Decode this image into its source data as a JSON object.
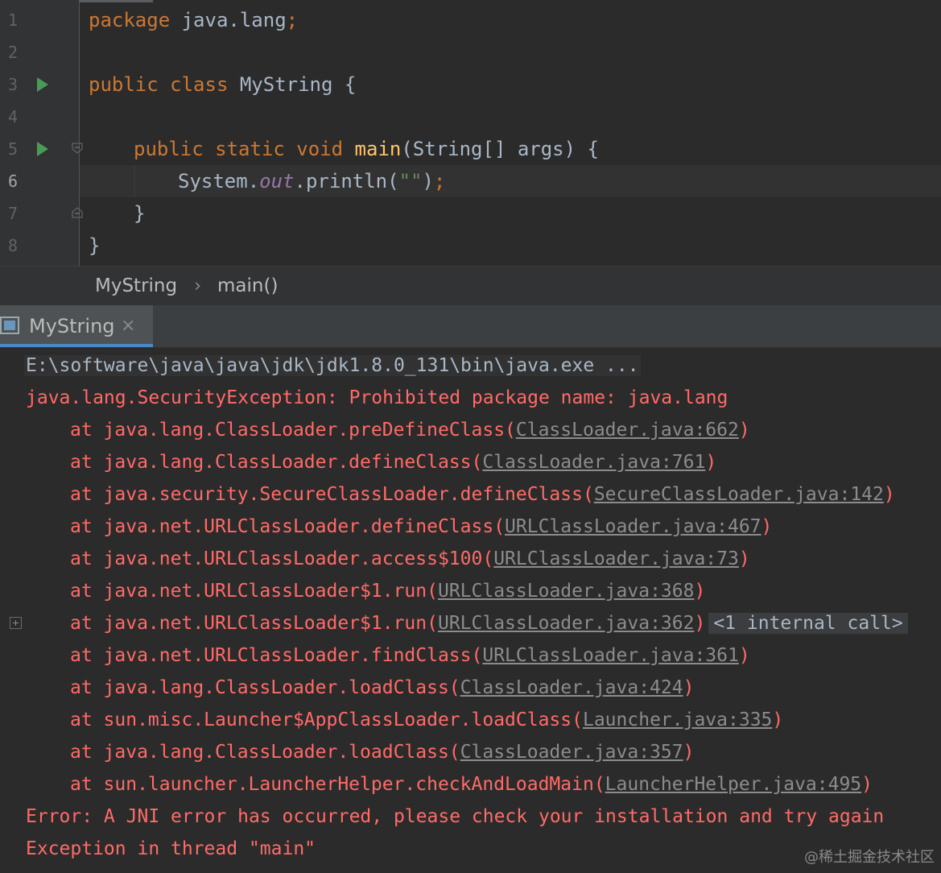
{
  "editor": {
    "line_numbers": [
      "1",
      "2",
      "3",
      "4",
      "5",
      "6",
      "7",
      "8"
    ],
    "lines": {
      "l1": {
        "kw": "package",
        "rest": " java.lang",
        "semi": ";"
      },
      "l3": {
        "kw": "public class",
        "rest": " MyString {"
      },
      "l5": {
        "kw": "public static void",
        "sp": " ",
        "fn": "main",
        "rest": "(String[] args) {"
      },
      "l6": {
        "a": "System.",
        "field": "out",
        "b": ".println(",
        "str": "\"\"",
        "c": ")",
        "semi": ";"
      },
      "l7": {
        "rest": "}"
      },
      "l8": {
        "rest": "}"
      }
    }
  },
  "breadcrumb": {
    "class": "MyString",
    "separator": "›",
    "method": "main()"
  },
  "run_panel": {
    "tab_label": "MyString",
    "close_glyph": "×"
  },
  "console": {
    "command": "E:\\software\\java\\java\\jdk\\jdk1.8.0_131\\bin\\java.exe ...",
    "exception": "java.lang.SecurityException: Prohibited package name: java.lang",
    "frames": [
      {
        "text": "at java.lang.ClassLoader.preDefineClass(",
        "link": "ClassLoader.java:662",
        "end": ")"
      },
      {
        "text": "at java.lang.ClassLoader.defineClass(",
        "link": "ClassLoader.java:761",
        "end": ")"
      },
      {
        "text": "at java.security.SecureClassLoader.defineClass(",
        "link": "SecureClassLoader.java:142",
        "end": ")"
      },
      {
        "text": "at java.net.URLClassLoader.defineClass(",
        "link": "URLClassLoader.java:467",
        "end": ")"
      },
      {
        "text": "at java.net.URLClassLoader.access$100(",
        "link": "URLClassLoader.java:73",
        "end": ")"
      },
      {
        "text": "at java.net.URLClassLoader$1.run(",
        "link": "URLClassLoader.java:368",
        "end": ")"
      },
      {
        "text": "at java.net.URLClassLoader$1.run(",
        "link": "URLClassLoader.java:362",
        "end": ")",
        "extra": "<1 internal call>"
      },
      {
        "text": "at java.net.URLClassLoader.findClass(",
        "link": "URLClassLoader.java:361",
        "end": ")"
      },
      {
        "text": "at java.lang.ClassLoader.loadClass(",
        "link": "ClassLoader.java:424",
        "end": ")"
      },
      {
        "text": "at sun.misc.Launcher$AppClassLoader.loadClass(",
        "link": "Launcher.java:335",
        "end": ")"
      },
      {
        "text": "at java.lang.ClassLoader.loadClass(",
        "link": "ClassLoader.java:357",
        "end": ")"
      },
      {
        "text": "at sun.launcher.LauncherHelper.checkAndLoadMain(",
        "link": "LauncherHelper.java:495",
        "end": ")"
      }
    ],
    "error": "Error: A JNI error has occurred, please check your installation and try again",
    "thread": "Exception in thread \"main\""
  },
  "watermark": "@稀土掘金技术社区",
  "colors": {
    "keyword": "#cc7832",
    "error_text": "#ff6b68",
    "link": "#8c8c8c",
    "run_icon": "#499c54",
    "tab_underline": "#4a88c7"
  }
}
